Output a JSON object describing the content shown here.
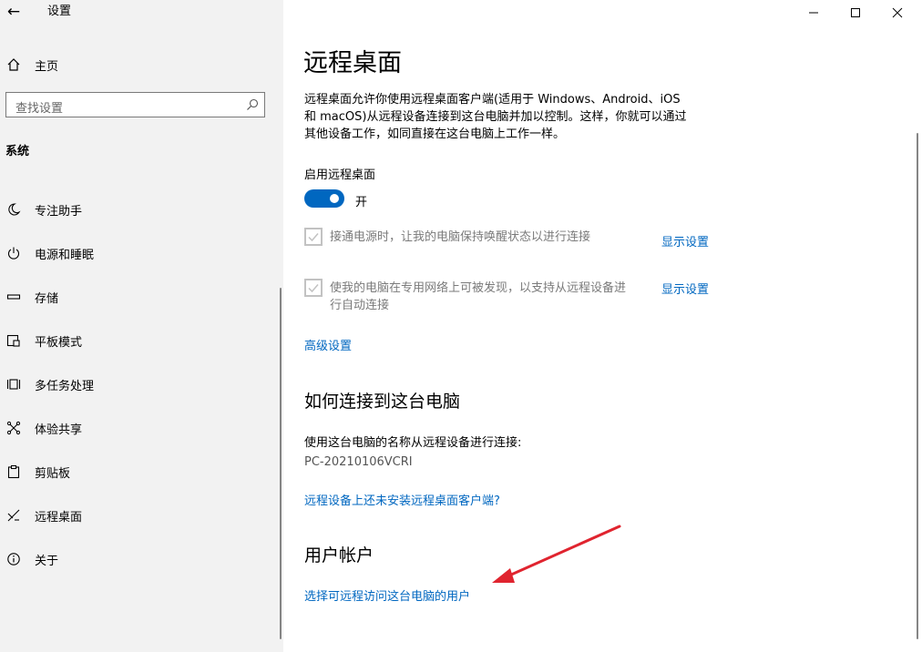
{
  "titlebar": {
    "title": "设置"
  },
  "sidebar": {
    "home_label": "主页",
    "search_placeholder": "查找设置",
    "group_title": "系统",
    "items": [
      {
        "label": "专注助手",
        "icon": "moon-icon"
      },
      {
        "label": "电源和睡眠",
        "icon": "power-icon"
      },
      {
        "label": "存储",
        "icon": "storage-icon"
      },
      {
        "label": "平板模式",
        "icon": "tablet-icon"
      },
      {
        "label": "多任务处理",
        "icon": "multitask-icon"
      },
      {
        "label": "体验共享",
        "icon": "share-icon"
      },
      {
        "label": "剪贴板",
        "icon": "clipboard-icon"
      },
      {
        "label": "远程桌面",
        "icon": "remote-desktop-icon"
      },
      {
        "label": "关于",
        "icon": "info-icon"
      }
    ]
  },
  "main": {
    "title": "远程桌面",
    "description_lines": [
      "远程桌面允许你使用远程桌面客户端(适用于 Windows、Android、iOS",
      "和 macOS)从远程设备连接到这台电脑并加以控制。这样，你就可以通过",
      "其他设备工作，如同直接在这台电脑上工作一样。"
    ],
    "enable_label": "启用远程桌面",
    "toggle_state": "开",
    "toggle_on": true,
    "options": [
      {
        "lines": [
          "接通电源时，让我的电脑保持唤醒状态以进行连接"
        ],
        "link": "显示设置",
        "checked": true
      },
      {
        "lines": [
          "使我的电脑在专用网络上可被发现，以支持从远程设备进",
          "行自动连接"
        ],
        "link": "显示设置",
        "checked": true
      }
    ],
    "advanced_link": "高级设置",
    "connect_heading": "如何连接到这台电脑",
    "connect_text": "使用这台电脑的名称从远程设备进行连接:",
    "pc_name": "PC-20210106VCRI",
    "no_client_link": "远程设备上还未安装远程桌面客户端?",
    "accounts_heading": "用户帐户",
    "select_users_link": "选择可远程访问这台电脑的用户"
  },
  "colors": {
    "accent": "#0067c0",
    "sidebar_bg": "#f2f2f2",
    "arrow": "#e0242f"
  }
}
